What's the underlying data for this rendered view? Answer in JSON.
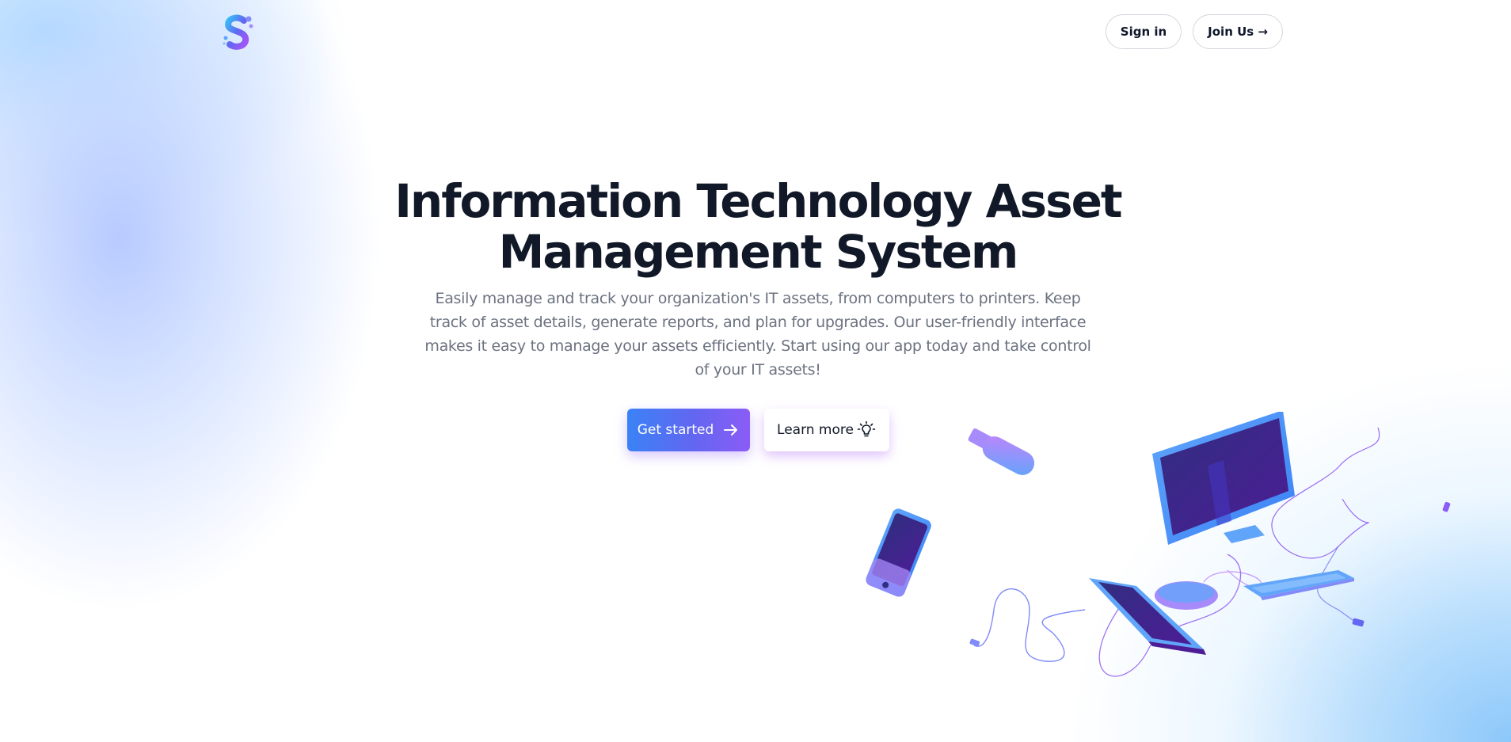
{
  "header": {
    "logo_icon": "gradient-s-logo-icon",
    "signin_label": "Sign in",
    "join_label": "Join Us →"
  },
  "hero": {
    "title_line1": "Information Technology Asset",
    "title_line2": "Management System",
    "description": "Easily manage and track your organization's IT assets, from computers to printers. Keep track of asset details, generate reports, and plan for upgrades. Our user-friendly interface makes it easy to manage your assets efficiently. Start using our app today and take control of your IT assets!",
    "primary_cta_label": "Get started",
    "primary_cta_icon": "arrow-right-icon",
    "secondary_cta_label": "Learn more",
    "secondary_cta_icon": "lightbulb-icon"
  },
  "illustration": {
    "name": "it-devices-illustration",
    "items": [
      "usb-drive-icon",
      "smartphone-icon",
      "monitor-icon",
      "laptop-icon",
      "mouse-icon",
      "keyboard-icon"
    ]
  },
  "colors": {
    "accent_start": "#3b82f6",
    "accent_end": "#8b5cf6",
    "heading": "#111827",
    "body_text": "#6b7280"
  }
}
